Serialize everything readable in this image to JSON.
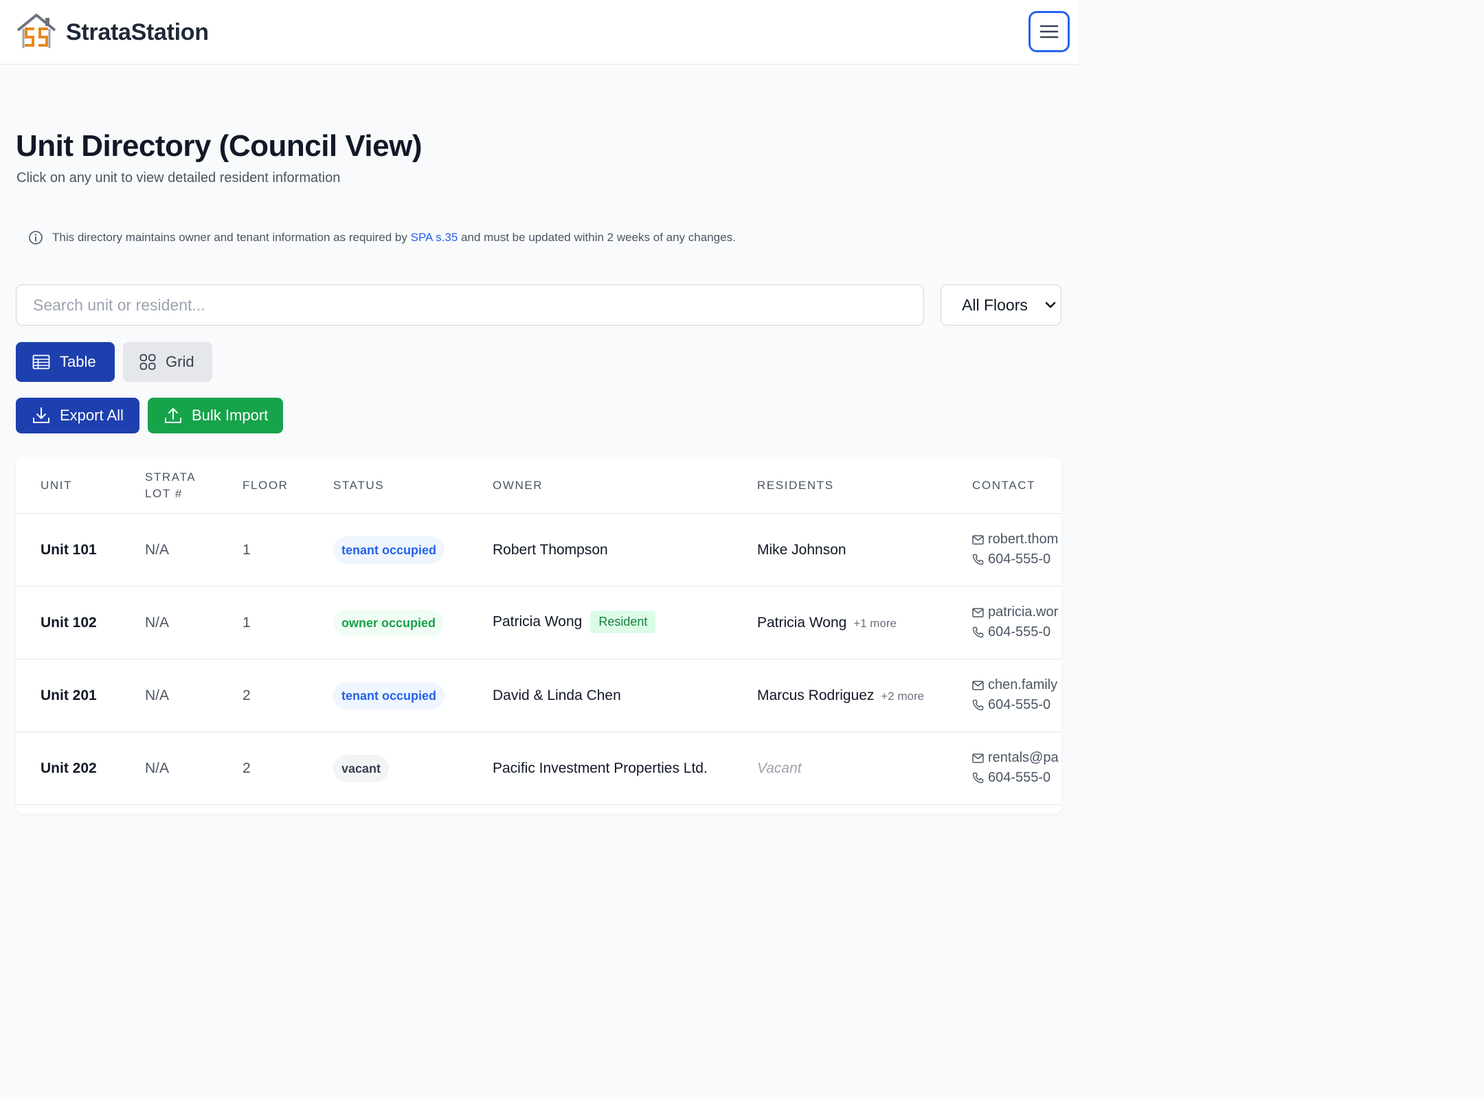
{
  "app": {
    "brand": "StrataStation"
  },
  "page": {
    "title": "Unit Directory (Council View)",
    "subtitle": "Click on any unit to view detailed resident information"
  },
  "notice": {
    "before": "This directory maintains owner and tenant information as required by",
    "link": "SPA s.35",
    "after": "and must be updated within 2 weeks of any changes."
  },
  "search": {
    "placeholder": "Search unit or resident..."
  },
  "floor_filter": {
    "selected": "All Floors"
  },
  "view_toggle": {
    "table_label": "Table",
    "grid_label": "Grid",
    "active": "table"
  },
  "actions": {
    "export_label": "Export All",
    "import_label": "Bulk Import"
  },
  "colors": {
    "primary": "#1e40af",
    "success": "#16a34a",
    "link": "#2563eb"
  },
  "table": {
    "headers": {
      "unit": "UNIT",
      "strata_lot_1": "STRATA",
      "strata_lot_2": "LOT #",
      "floor": "FLOOR",
      "status": "STATUS",
      "owner": "OWNER",
      "residents": "RESIDENTS",
      "contact": "CONTACT"
    },
    "rows": [
      {
        "unit": "Unit 101",
        "strata_lot": "N/A",
        "floor": "1",
        "status": "tenant occupied",
        "owner": "Robert Thompson",
        "owner_tag": "",
        "residents": "Mike Johnson",
        "residents_more": "",
        "email": "robert.thom",
        "phone": "604-555-0"
      },
      {
        "unit": "Unit 102",
        "strata_lot": "N/A",
        "floor": "1",
        "status": "owner occupied",
        "owner": "Patricia Wong",
        "owner_tag": "Resident",
        "residents": "Patricia Wong",
        "residents_more": "+1 more",
        "email": "patricia.wor",
        "phone": "604-555-0"
      },
      {
        "unit": "Unit 201",
        "strata_lot": "N/A",
        "floor": "2",
        "status": "tenant occupied",
        "owner": "David & Linda Chen",
        "owner_tag": "",
        "residents": "Marcus Rodriguez",
        "residents_more": "+2 more",
        "email": "chen.family",
        "phone": "604-555-0"
      },
      {
        "unit": "Unit 202",
        "strata_lot": "N/A",
        "floor": "2",
        "status": "vacant",
        "owner": "Pacific Investment Properties Ltd.",
        "owner_tag": "",
        "residents": "Vacant",
        "residents_more": "",
        "email": "rentals@pa",
        "phone": "604-555-0"
      }
    ]
  }
}
